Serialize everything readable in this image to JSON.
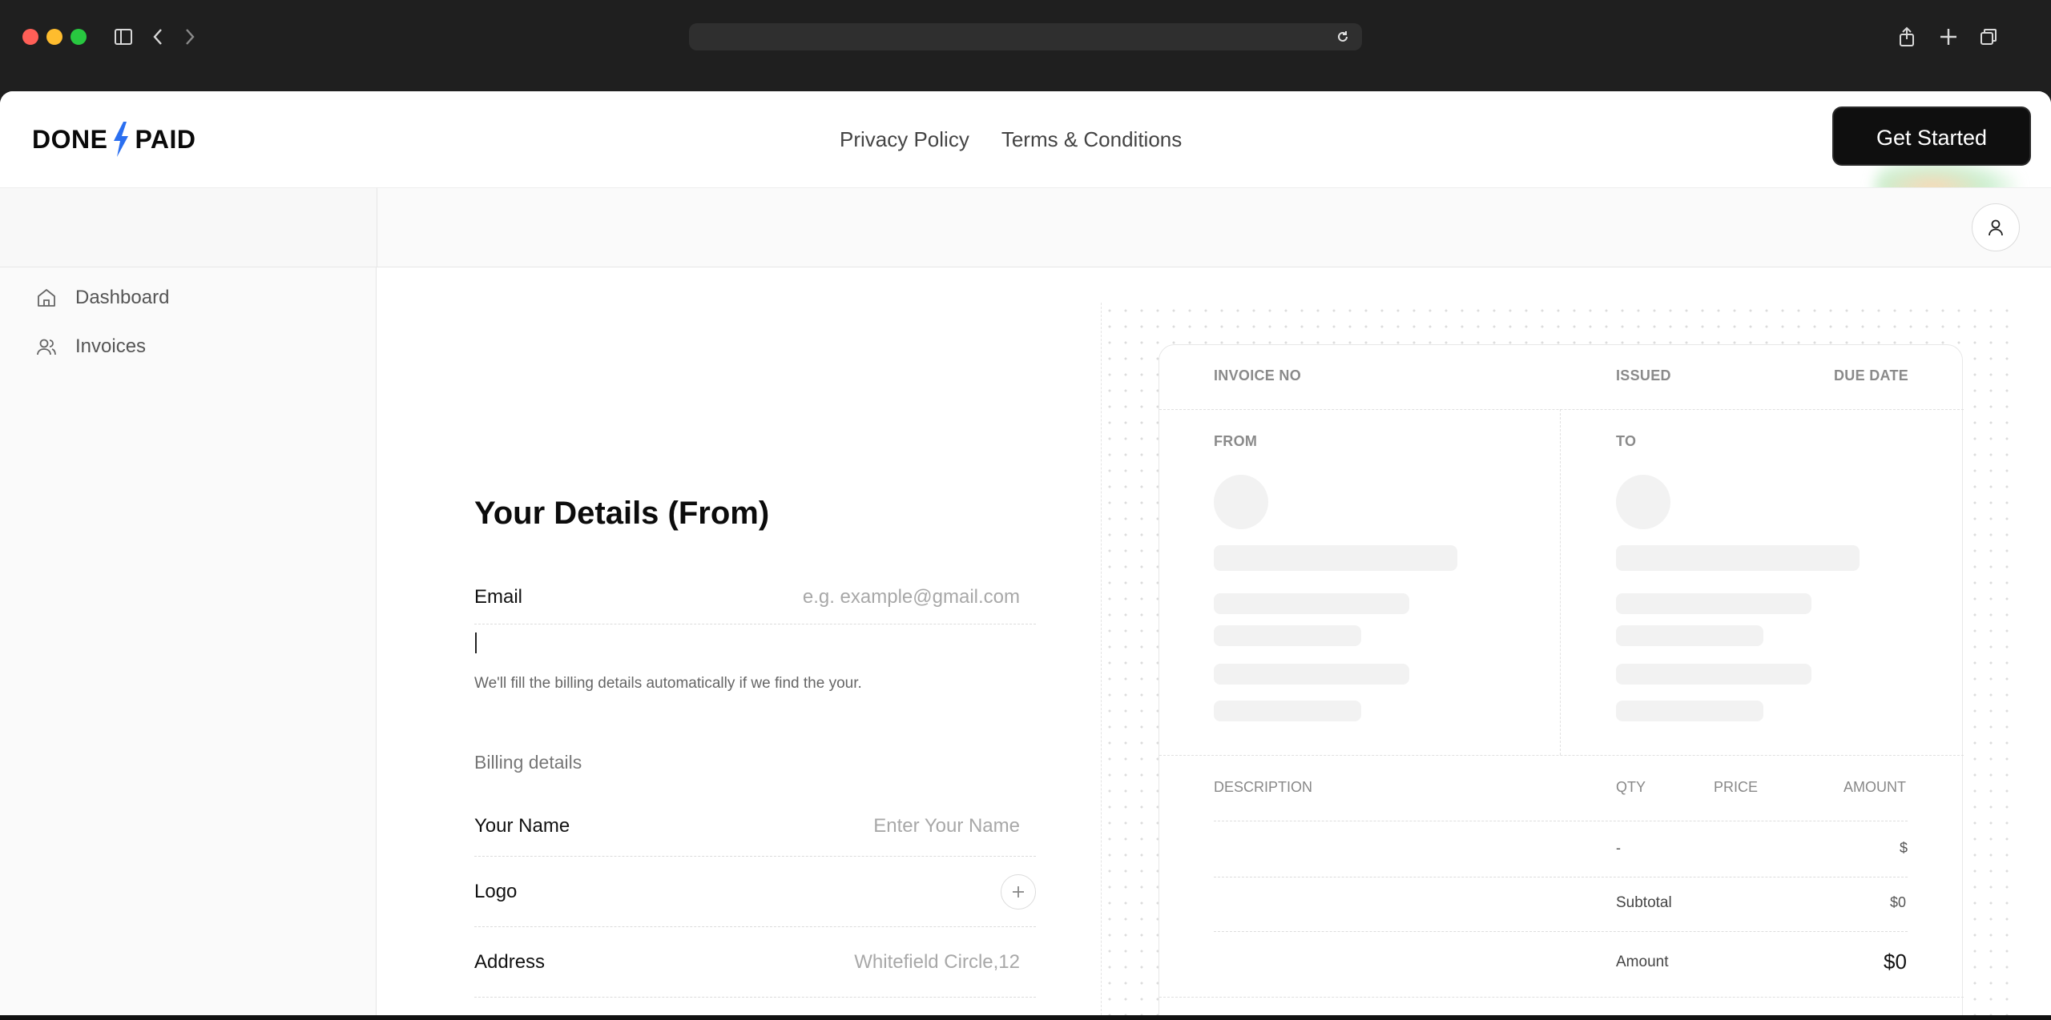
{
  "brand": {
    "logo_left": "DONE",
    "logo_right": "PAID",
    "accent": "#2b6ff0"
  },
  "nav": {
    "links": [
      "Privacy Policy",
      "Terms & Conditions"
    ],
    "cta": "Get Started"
  },
  "sidebar": {
    "items": [
      {
        "label": "Dashboard",
        "icon": "home-icon"
      },
      {
        "label": "Invoices",
        "icon": "users-icon"
      }
    ]
  },
  "form": {
    "title": "Your Details (From)",
    "email": {
      "label": "Email",
      "placeholder": "e.g. example@gmail.com"
    },
    "hint": "We'll fill the billing details automatically if we find the your.",
    "billing_label": "Billing details",
    "name": {
      "label": "Your Name",
      "placeholder": "Enter Your Name"
    },
    "logo": {
      "label": "Logo"
    },
    "address": {
      "label": "Address",
      "placeholder": "Whitefield Circle,12"
    }
  },
  "invoice": {
    "invoice_no": "INVOICE NO",
    "issued": "ISSUED",
    "due_date": "DUE DATE",
    "from": "FROM",
    "to": "TO",
    "columns": {
      "description": "DESCRIPTION",
      "qty": "QTY",
      "price": "PRICE",
      "amount": "AMOUNT"
    },
    "item_row": {
      "qty": "-",
      "amount": "$"
    },
    "subtotal_label": "Subtotal",
    "subtotal_value": "$0",
    "amount_label": "Amount",
    "amount_value": "$0"
  }
}
